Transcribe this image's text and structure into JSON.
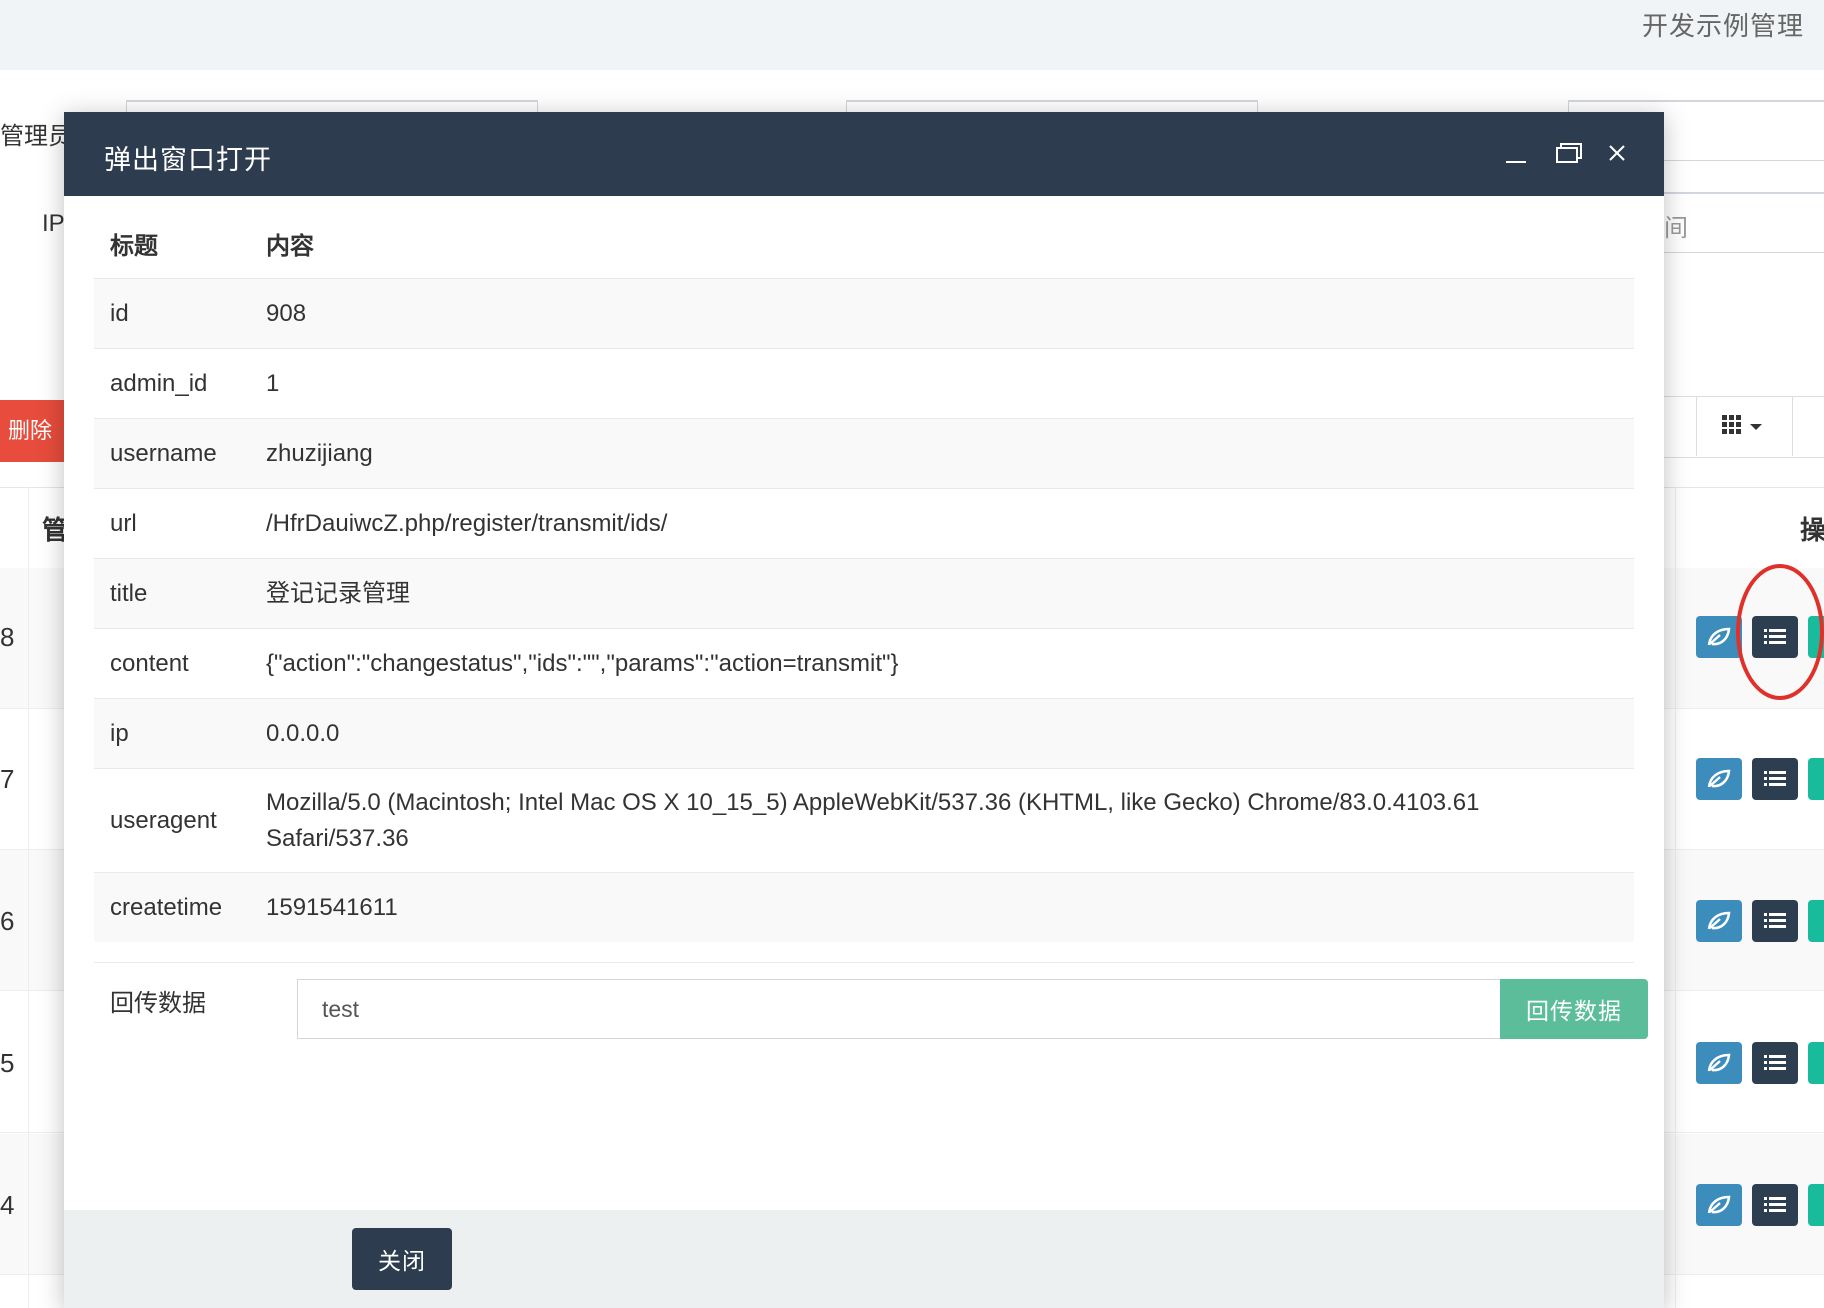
{
  "background": {
    "topbar_title": "开发示例管理",
    "admin_label": "管理员",
    "ip_label": "IP",
    "time_placeholder_fragment": "间",
    "delete_button": "删除",
    "table_head": {
      "col_manager": "管",
      "col_op": "操"
    },
    "row_ids": [
      "8",
      "7",
      "6",
      "5",
      "4"
    ]
  },
  "modal": {
    "title": "弹出窗口打开",
    "table": {
      "header_key": "标题",
      "header_value": "内容",
      "rows": [
        {
          "key": "id",
          "value": "908"
        },
        {
          "key": "admin_id",
          "value": "1"
        },
        {
          "key": "username",
          "value": "zhuzijiang"
        },
        {
          "key": "url",
          "value": "/HfrDauiwcZ.php/register/transmit/ids/"
        },
        {
          "key": "title",
          "value": "登记记录管理"
        },
        {
          "key": "content",
          "value": "{\"action\":\"changestatus\",\"ids\":\"\",\"params\":\"action=transmit\"}"
        },
        {
          "key": "ip",
          "value": "0.0.0.0"
        },
        {
          "key": "useragent",
          "value": "Mozilla/5.0 (Macintosh; Intel Mac OS X 10_15_5) AppleWebKit/537.36 (KHTML, like Gecko) Chrome/83.0.4103.61 Safari/537.36"
        },
        {
          "key": "createtime",
          "value": "1591541611"
        }
      ]
    },
    "callback": {
      "label": "回传数据",
      "input_value": "test",
      "button_label": "回传数据"
    },
    "footer": {
      "close_label": "关闭"
    }
  },
  "icons": {
    "minimize": "minimize-icon",
    "maximize": "maximize-icon",
    "close": "close-icon",
    "leaf": "leaf-icon",
    "list": "list-icon",
    "grid": "grid-icon"
  },
  "colors": {
    "header_bg": "#2d3c4f",
    "callback_button": "#5bbd9a",
    "delete_button": "#e74c3c",
    "annotation": "#e0302a"
  }
}
